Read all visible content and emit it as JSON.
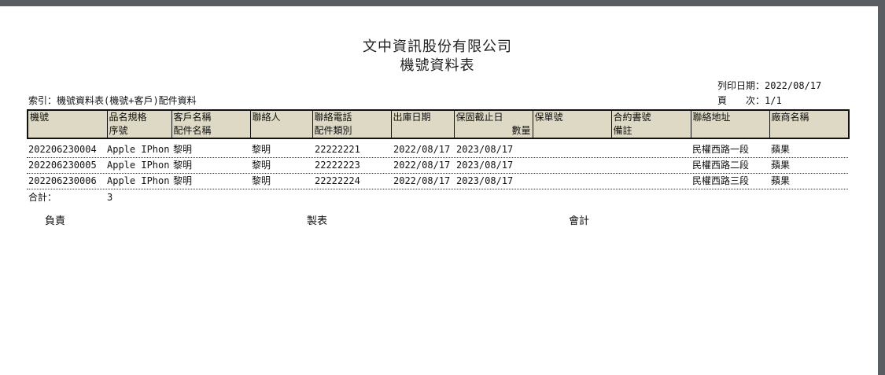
{
  "report": {
    "company": "文中資訊股份有限公司",
    "title": "機號資料表",
    "print_date_label": "列印日期：2022/08/17",
    "page_label": "頁　　次：1/1",
    "index_label": "索引：機號資料表(機號+客戶)配件資料"
  },
  "columns": [
    {
      "line1": "機號",
      "line2": ""
    },
    {
      "line1": "品名規格",
      "line2": "序號"
    },
    {
      "line1": "客戶名稱",
      "line2": "配件名稱"
    },
    {
      "line1": "聯絡人",
      "line2": ""
    },
    {
      "line1": "聯絡電話",
      "line2": "配件類別"
    },
    {
      "line1": "出庫日期",
      "line2": ""
    },
    {
      "line1": "保固截止日",
      "line2": "數量"
    },
    {
      "line1": "保單號",
      "line2": ""
    },
    {
      "line1": "合約書號",
      "line2": "備註"
    },
    {
      "line1": "聯絡地址",
      "line2": ""
    },
    {
      "line1": "廠商名稱",
      "line2": ""
    }
  ],
  "rows": [
    {
      "machine_no": "202206230004",
      "product": "Apple IPhon",
      "customer": "黎明",
      "contact": "黎明",
      "phone": "22222221",
      "out_date": "2022/08/17",
      "warranty_end": "2023/08/17",
      "address": "民權西路一段",
      "vendor": "蘋果"
    },
    {
      "machine_no": "202206230005",
      "product": "Apple IPhon",
      "customer": "黎明",
      "contact": "黎明",
      "phone": "22222223",
      "out_date": "2022/08/17",
      "warranty_end": "2023/08/17",
      "address": "民權西路二段",
      "vendor": "蘋果"
    },
    {
      "machine_no": "202206230006",
      "product": "Apple IPhon",
      "customer": "黎明",
      "contact": "黎明",
      "phone": "22222224",
      "out_date": "2022/08/17",
      "warranty_end": "2023/08/17",
      "address": "民權西路三段",
      "vendor": "蘋果"
    }
  ],
  "total": {
    "label": "合計：",
    "value": "3"
  },
  "signatures": {
    "responsible": "負責",
    "prepared_by": "製表",
    "accounting": "會計"
  }
}
